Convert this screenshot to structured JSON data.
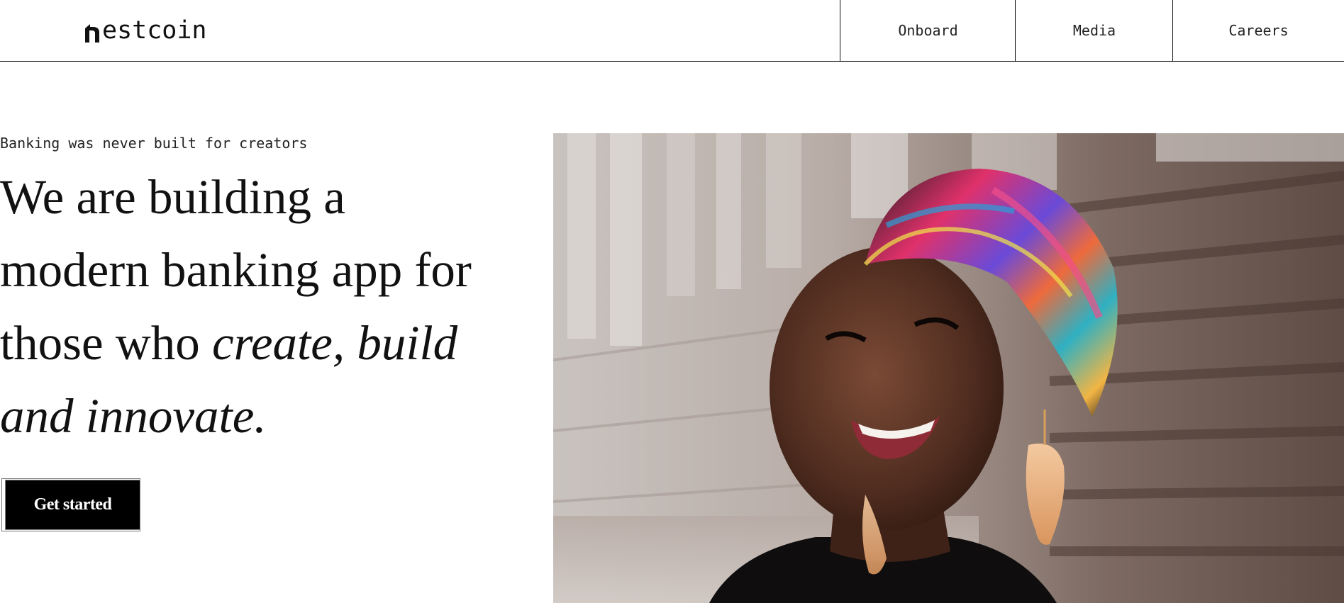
{
  "brand": {
    "logo_text": "estcoin",
    "logo_mark_icon": "house-n-logo-icon"
  },
  "nav": {
    "items": [
      {
        "label": "Onboard"
      },
      {
        "label": "Media"
      },
      {
        "label": "Careers"
      }
    ]
  },
  "hero": {
    "tagline": "Banking was never built for creators",
    "headline_line1": "We are building a",
    "headline_line2": "modern banking app for",
    "headline_line3_plain": "those who ",
    "headline_line3_italic": "create, build",
    "headline_line4_italic": "and innovate.",
    "cta_label": "Get started",
    "image_icon": "woman-smiling-headwrap-photo"
  },
  "colors": {
    "text": "#111111",
    "background": "#ffffff",
    "cta_background": "#000000",
    "cta_text": "#ffffff"
  }
}
